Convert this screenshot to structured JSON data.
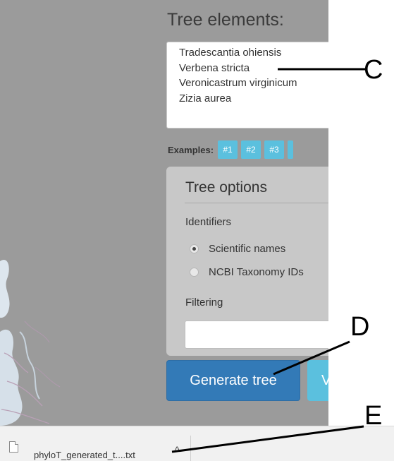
{
  "tree_elements": {
    "title": "Tree elements:",
    "lines": [
      "Tradescantia ohiensis",
      "Verbena stricta",
      "Veronicastrum virginicum",
      "Zizia aurea"
    ]
  },
  "examples": {
    "label": "Examples:",
    "buttons": [
      "#1",
      "#2",
      "#3"
    ]
  },
  "tree_options": {
    "title": "Tree options",
    "identifiers_label": "Identifiers",
    "radio_options": [
      {
        "label": "Scientific names",
        "selected": true
      },
      {
        "label": "NCBI Taxonomy IDs",
        "selected": false
      }
    ],
    "filtering_label": "Filtering",
    "filter_value": ""
  },
  "buttons": {
    "generate": "Generate tree",
    "second_partial": "V"
  },
  "download_bar": {
    "file_name": "phyloT_generated_t....txt",
    "icon": "file-icon",
    "chevron_icon": "chevron-up-icon",
    "chevron_glyph": "^"
  },
  "callouts": {
    "c": "C",
    "d": "D",
    "e": "E"
  },
  "colors": {
    "screen_bg": "#9b9b9b",
    "primary": "#337ab7",
    "info": "#5bc0de",
    "panel": "#c8c8c8"
  }
}
